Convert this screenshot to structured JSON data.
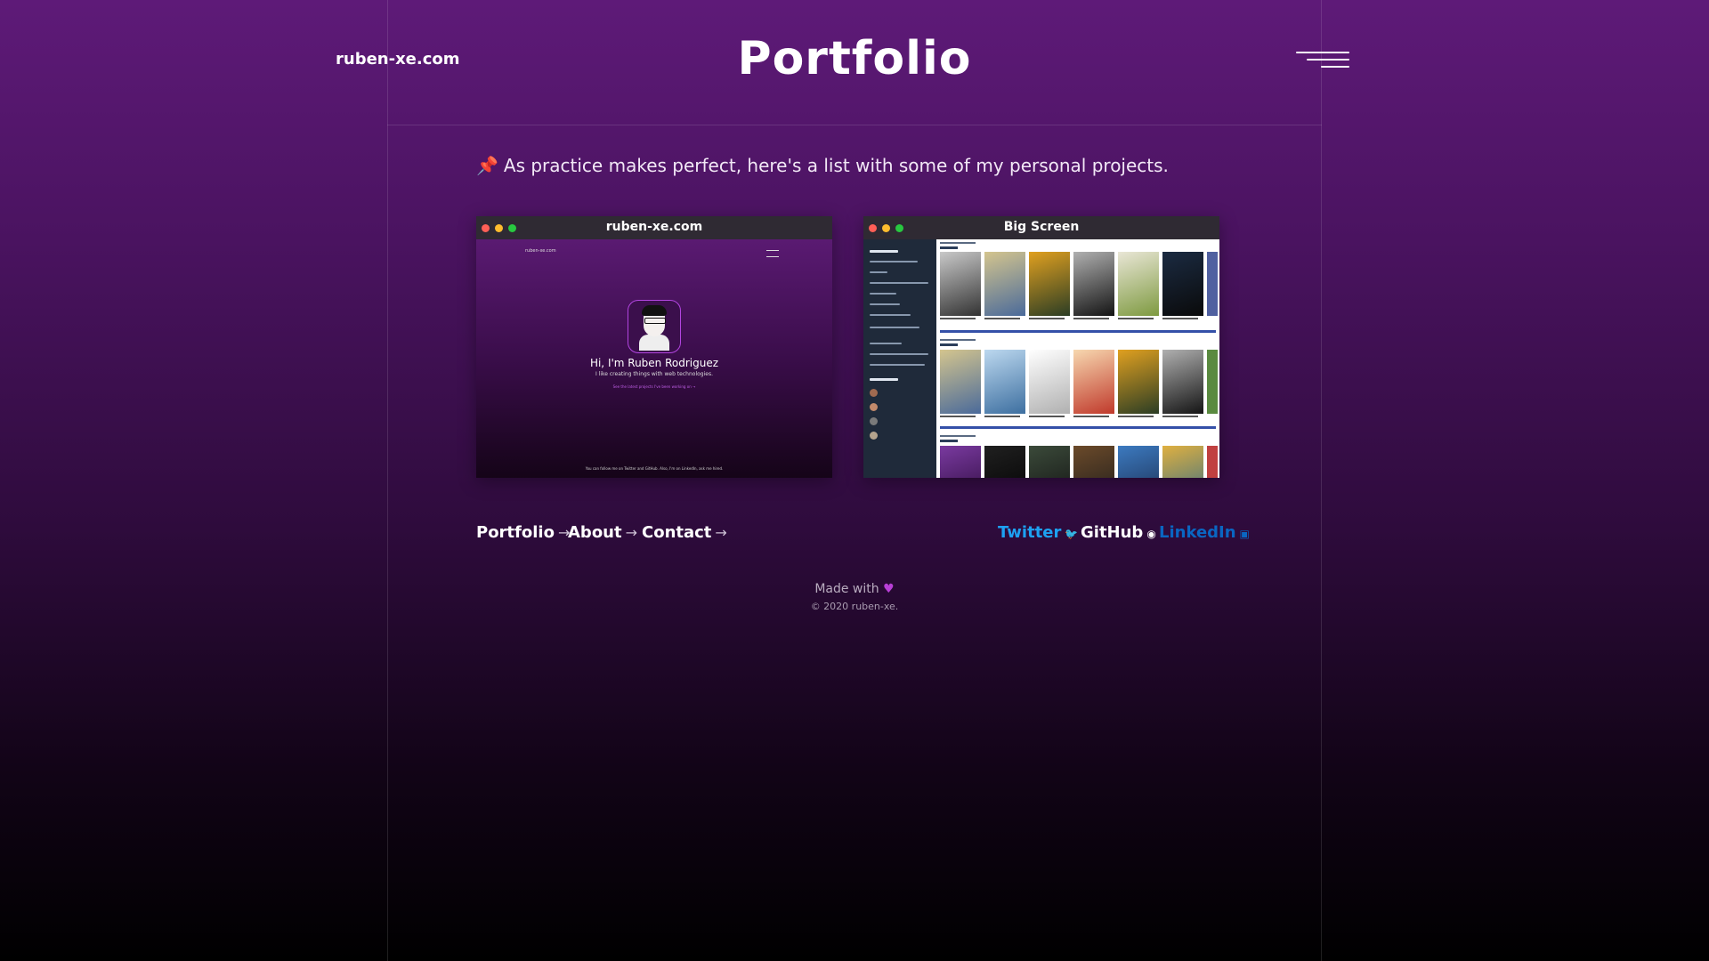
{
  "header": {
    "brand": "ruben-xe.com",
    "title": "Portfolio"
  },
  "intro": {
    "icon": "pushpin-icon",
    "text": "As practice makes perfect, here's a list with some of my personal projects."
  },
  "projects": [
    {
      "title": "ruben-xe.com",
      "preview": {
        "brand": "ruben-xe.com",
        "greeting": "Hi, I'm Ruben Rodriguez",
        "subtitle": "I like creating things with web technologies.",
        "link": "See the latest projects I've been working on →",
        "footer": "You can follow me on Twitter and GitHub. Also, I'm on LinkedIn, ask me hired."
      }
    },
    {
      "title": "Big Screen"
    }
  ],
  "footer": {
    "nav": [
      "Portfolio",
      "About",
      "Contact"
    ],
    "social": [
      {
        "label": "Twitter",
        "icon": "twitter-icon",
        "color": "#1da1f2"
      },
      {
        "label": "GitHub",
        "icon": "github-icon",
        "color": "#ffffff"
      },
      {
        "label": "LinkedIn",
        "icon": "linkedin-icon",
        "color": "#0a66c2"
      }
    ],
    "made_with": "Made with",
    "copyright": "© 2020 ruben-xe."
  },
  "colors": {
    "accent": "#b83fd6",
    "twitter": "#1da1f2",
    "linkedin": "#0a66c2"
  }
}
